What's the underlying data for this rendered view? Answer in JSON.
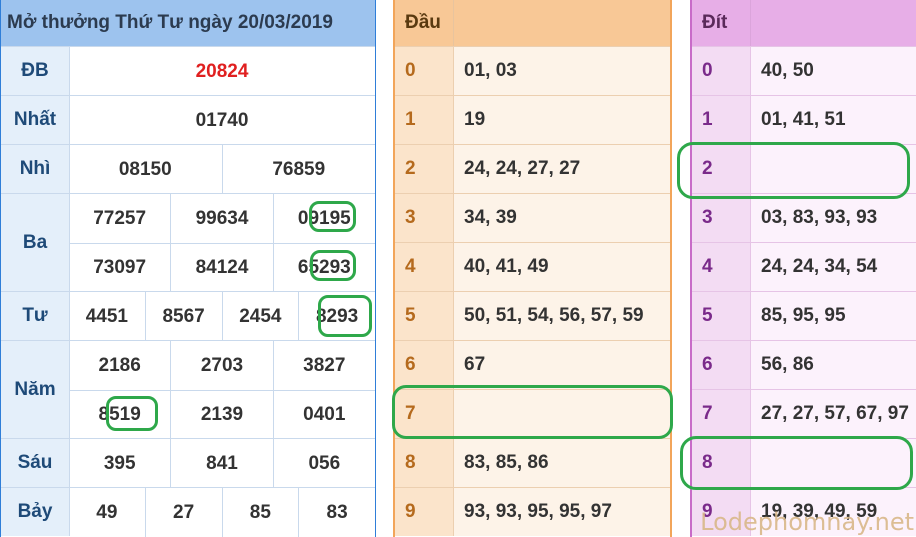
{
  "results": {
    "title": "Mở thưởng Thứ Tư ngày 20/03/2019",
    "rows": [
      {
        "label": "ĐB",
        "lines": [
          [
            "20824"
          ]
        ]
      },
      {
        "label": "Nhất",
        "lines": [
          [
            "01740"
          ]
        ]
      },
      {
        "label": "Nhì",
        "lines": [
          [
            "08150",
            "76859"
          ]
        ]
      },
      {
        "label": "Ba",
        "lines": [
          [
            "77257",
            "99634",
            "09195"
          ],
          [
            "73097",
            "84124",
            "65293"
          ]
        ]
      },
      {
        "label": "Tư",
        "lines": [
          [
            "4451",
            "8567",
            "2454",
            "8293"
          ]
        ]
      },
      {
        "label": "Năm",
        "lines": [
          [
            "2186",
            "2703",
            "3827"
          ],
          [
            "8519",
            "2139",
            "0401"
          ]
        ]
      },
      {
        "label": "Sáu",
        "lines": [
          [
            "395",
            "841",
            "056"
          ]
        ]
      },
      {
        "label": "Bảy",
        "lines": [
          [
            "49",
            "27",
            "85",
            "83"
          ]
        ]
      }
    ],
    "special_color": "#e02020"
  },
  "dau": {
    "header": "Đầu",
    "rows": [
      {
        "key": "0",
        "value": "01, 03"
      },
      {
        "key": "1",
        "value": "19"
      },
      {
        "key": "2",
        "value": "24, 24, 27, 27"
      },
      {
        "key": "3",
        "value": "34, 39"
      },
      {
        "key": "4",
        "value": "40, 41, 49"
      },
      {
        "key": "5",
        "value": "50, 51, 54, 56, 57, 59"
      },
      {
        "key": "6",
        "value": "67"
      },
      {
        "key": "7",
        "value": ""
      },
      {
        "key": "8",
        "value": "83, 85, 86"
      },
      {
        "key": "9",
        "value": "93, 93, 95, 95, 97"
      }
    ]
  },
  "dit": {
    "header": "Đít",
    "rows": [
      {
        "key": "0",
        "value": "40, 50"
      },
      {
        "key": "1",
        "value": "01, 41, 51"
      },
      {
        "key": "2",
        "value": ""
      },
      {
        "key": "3",
        "value": "03, 83, 93, 93"
      },
      {
        "key": "4",
        "value": "24, 24, 34, 54"
      },
      {
        "key": "5",
        "value": "85, 95, 95"
      },
      {
        "key": "6",
        "value": "56, 86"
      },
      {
        "key": "7",
        "value": "27, 27, 57, 67, 97"
      },
      {
        "key": "8",
        "value": ""
      },
      {
        "key": "9",
        "value": "19, 39, 49, 59"
      }
    ]
  },
  "watermark": "Lodephomnay.net",
  "colors": {
    "results_header": "#9dc3ee",
    "dau_header": "#f8c896",
    "dit_header": "#e7aee7",
    "highlight_ring": "#2ea84a"
  }
}
